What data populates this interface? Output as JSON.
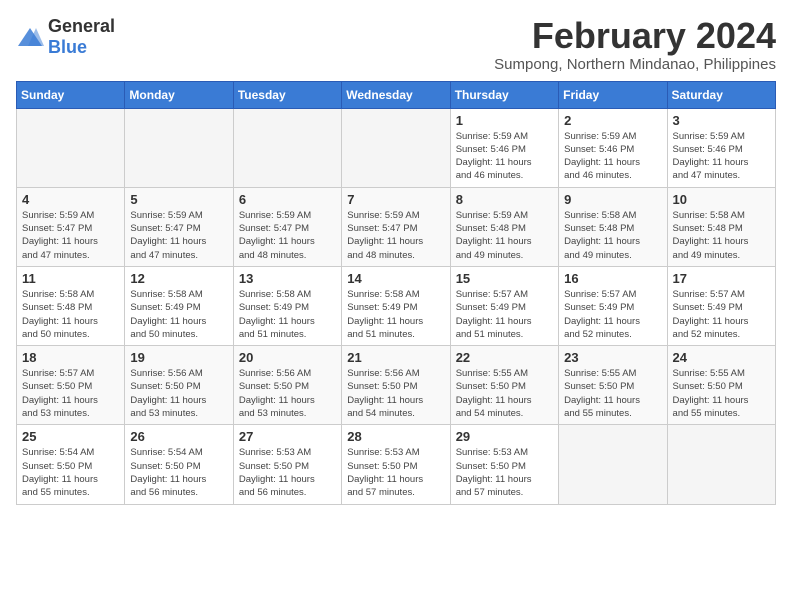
{
  "logo": {
    "text_general": "General",
    "text_blue": "Blue"
  },
  "calendar": {
    "title": "February 2024",
    "subtitle": "Sumpong, Northern Mindanao, Philippines"
  },
  "headers": [
    "Sunday",
    "Monday",
    "Tuesday",
    "Wednesday",
    "Thursday",
    "Friday",
    "Saturday"
  ],
  "weeks": [
    [
      {
        "day": "",
        "info": ""
      },
      {
        "day": "",
        "info": ""
      },
      {
        "day": "",
        "info": ""
      },
      {
        "day": "",
        "info": ""
      },
      {
        "day": "1",
        "info": "Sunrise: 5:59 AM\nSunset: 5:46 PM\nDaylight: 11 hours\nand 46 minutes."
      },
      {
        "day": "2",
        "info": "Sunrise: 5:59 AM\nSunset: 5:46 PM\nDaylight: 11 hours\nand 46 minutes."
      },
      {
        "day": "3",
        "info": "Sunrise: 5:59 AM\nSunset: 5:46 PM\nDaylight: 11 hours\nand 47 minutes."
      }
    ],
    [
      {
        "day": "4",
        "info": "Sunrise: 5:59 AM\nSunset: 5:47 PM\nDaylight: 11 hours\nand 47 minutes."
      },
      {
        "day": "5",
        "info": "Sunrise: 5:59 AM\nSunset: 5:47 PM\nDaylight: 11 hours\nand 47 minutes."
      },
      {
        "day": "6",
        "info": "Sunrise: 5:59 AM\nSunset: 5:47 PM\nDaylight: 11 hours\nand 48 minutes."
      },
      {
        "day": "7",
        "info": "Sunrise: 5:59 AM\nSunset: 5:47 PM\nDaylight: 11 hours\nand 48 minutes."
      },
      {
        "day": "8",
        "info": "Sunrise: 5:59 AM\nSunset: 5:48 PM\nDaylight: 11 hours\nand 49 minutes."
      },
      {
        "day": "9",
        "info": "Sunrise: 5:58 AM\nSunset: 5:48 PM\nDaylight: 11 hours\nand 49 minutes."
      },
      {
        "day": "10",
        "info": "Sunrise: 5:58 AM\nSunset: 5:48 PM\nDaylight: 11 hours\nand 49 minutes."
      }
    ],
    [
      {
        "day": "11",
        "info": "Sunrise: 5:58 AM\nSunset: 5:48 PM\nDaylight: 11 hours\nand 50 minutes."
      },
      {
        "day": "12",
        "info": "Sunrise: 5:58 AM\nSunset: 5:49 PM\nDaylight: 11 hours\nand 50 minutes."
      },
      {
        "day": "13",
        "info": "Sunrise: 5:58 AM\nSunset: 5:49 PM\nDaylight: 11 hours\nand 51 minutes."
      },
      {
        "day": "14",
        "info": "Sunrise: 5:58 AM\nSunset: 5:49 PM\nDaylight: 11 hours\nand 51 minutes."
      },
      {
        "day": "15",
        "info": "Sunrise: 5:57 AM\nSunset: 5:49 PM\nDaylight: 11 hours\nand 51 minutes."
      },
      {
        "day": "16",
        "info": "Sunrise: 5:57 AM\nSunset: 5:49 PM\nDaylight: 11 hours\nand 52 minutes."
      },
      {
        "day": "17",
        "info": "Sunrise: 5:57 AM\nSunset: 5:49 PM\nDaylight: 11 hours\nand 52 minutes."
      }
    ],
    [
      {
        "day": "18",
        "info": "Sunrise: 5:57 AM\nSunset: 5:50 PM\nDaylight: 11 hours\nand 53 minutes."
      },
      {
        "day": "19",
        "info": "Sunrise: 5:56 AM\nSunset: 5:50 PM\nDaylight: 11 hours\nand 53 minutes."
      },
      {
        "day": "20",
        "info": "Sunrise: 5:56 AM\nSunset: 5:50 PM\nDaylight: 11 hours\nand 53 minutes."
      },
      {
        "day": "21",
        "info": "Sunrise: 5:56 AM\nSunset: 5:50 PM\nDaylight: 11 hours\nand 54 minutes."
      },
      {
        "day": "22",
        "info": "Sunrise: 5:55 AM\nSunset: 5:50 PM\nDaylight: 11 hours\nand 54 minutes."
      },
      {
        "day": "23",
        "info": "Sunrise: 5:55 AM\nSunset: 5:50 PM\nDaylight: 11 hours\nand 55 minutes."
      },
      {
        "day": "24",
        "info": "Sunrise: 5:55 AM\nSunset: 5:50 PM\nDaylight: 11 hours\nand 55 minutes."
      }
    ],
    [
      {
        "day": "25",
        "info": "Sunrise: 5:54 AM\nSunset: 5:50 PM\nDaylight: 11 hours\nand 55 minutes."
      },
      {
        "day": "26",
        "info": "Sunrise: 5:54 AM\nSunset: 5:50 PM\nDaylight: 11 hours\nand 56 minutes."
      },
      {
        "day": "27",
        "info": "Sunrise: 5:53 AM\nSunset: 5:50 PM\nDaylight: 11 hours\nand 56 minutes."
      },
      {
        "day": "28",
        "info": "Sunrise: 5:53 AM\nSunset: 5:50 PM\nDaylight: 11 hours\nand 57 minutes."
      },
      {
        "day": "29",
        "info": "Sunrise: 5:53 AM\nSunset: 5:50 PM\nDaylight: 11 hours\nand 57 minutes."
      },
      {
        "day": "",
        "info": ""
      },
      {
        "day": "",
        "info": ""
      }
    ]
  ]
}
